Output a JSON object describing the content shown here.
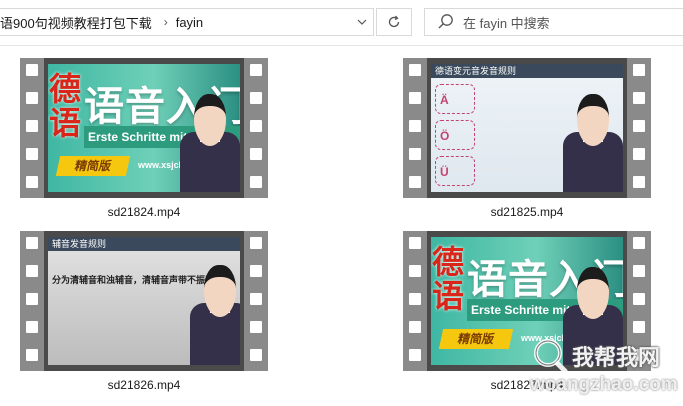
{
  "address_bar": {
    "crumbs": [
      "语900句视频教程打包下载",
      "fayin"
    ]
  },
  "search": {
    "placeholder": "在 fayin 中搜索"
  },
  "files": [
    {
      "name": "sd21824.mp4",
      "thumb": {
        "kind": "title",
        "side_word": "德语",
        "title": "语音入门",
        "subtitle": "Erste Schritte mit St",
        "badge": "精简版",
        "site": "www.xsjcles"
      }
    },
    {
      "name": "sd21825.mp4",
      "thumb": {
        "kind": "vowels",
        "heading": "德语变元音发音规则",
        "vowels": [
          "Ä",
          "Ö",
          "Ü"
        ]
      }
    },
    {
      "name": "sd21826.mp4",
      "thumb": {
        "kind": "consonant",
        "heading": "辅音发音规则",
        "line": "分为清辅音和浊辅音，清辅音声带不振动。"
      }
    },
    {
      "name": "sd21827.mp4",
      "thumb": {
        "kind": "title",
        "side_word": "德语",
        "title": "语音入门",
        "subtitle": "Erste Schritte mit",
        "badge": "精简版",
        "site": "www.xsjcles"
      }
    }
  ],
  "watermark": {
    "text": "我帮我网",
    "url": "woangzhao.com"
  },
  "colors": {
    "film": "#8a8a8a",
    "accent_green": "#3fb7a3",
    "title_red": "#d9251a",
    "badge_yellow": "#f5c80f"
  }
}
